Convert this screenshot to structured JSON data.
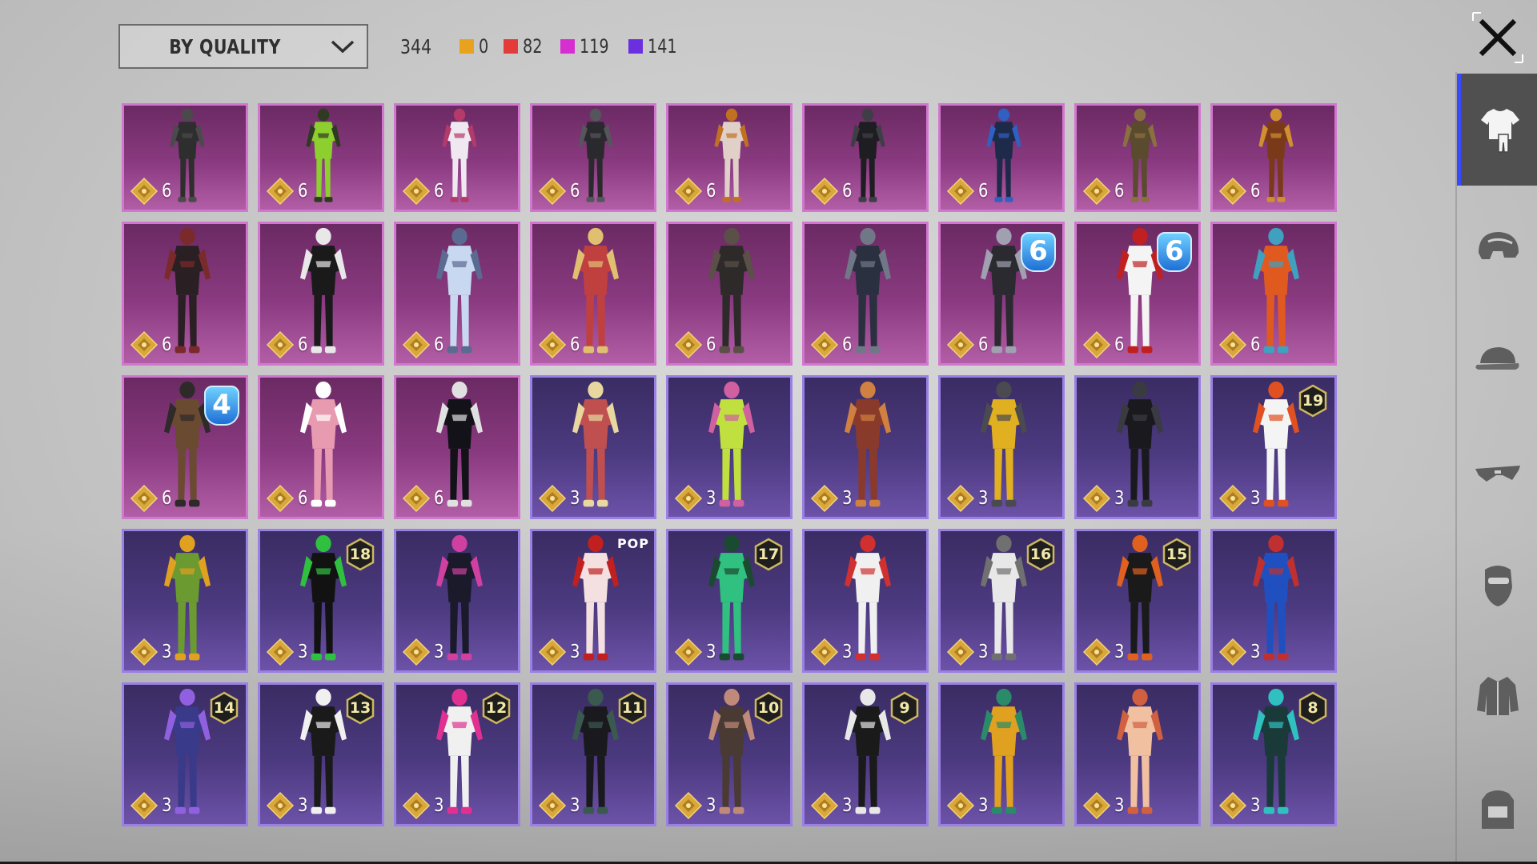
{
  "toolbar": {
    "sort_label": "BY QUALITY",
    "total_count": "344",
    "quality_counts": [
      {
        "value": "0",
        "color": "#e8a21e"
      },
      {
        "value": "82",
        "color": "#e53a3a"
      },
      {
        "value": "119",
        "color": "#d62ed0"
      },
      {
        "value": "141",
        "color": "#6b2fe0"
      }
    ]
  },
  "colors": {
    "mythic_border": "#d277cf",
    "legendary_border": "#9a7fe4",
    "active_tab_accent": "#3949ff"
  },
  "sidebar": {
    "tabs": [
      {
        "icon": "outfit-icon",
        "active": true
      },
      {
        "icon": "helmet-icon",
        "active": false
      },
      {
        "icon": "cap-icon",
        "active": false
      },
      {
        "icon": "sunglasses-icon",
        "active": false
      },
      {
        "icon": "mask-icon",
        "active": false
      },
      {
        "icon": "jacket-icon",
        "active": false
      },
      {
        "icon": "backpack-icon",
        "active": false
      }
    ]
  },
  "items": [
    {
      "rarity": "mythic",
      "points": "6",
      "badge": null,
      "palette": [
        "#2e2e2e",
        "#4a4a4a"
      ]
    },
    {
      "rarity": "mythic",
      "points": "6",
      "badge": null,
      "palette": [
        "#8ccf2e",
        "#2f3a22"
      ]
    },
    {
      "rarity": "mythic",
      "points": "6",
      "badge": null,
      "palette": [
        "#f0e8f0",
        "#b33a6a"
      ]
    },
    {
      "rarity": "mythic",
      "points": "6",
      "badge": null,
      "palette": [
        "#2a2a2e",
        "#55555c"
      ]
    },
    {
      "rarity": "mythic",
      "points": "6",
      "badge": null,
      "palette": [
        "#e0d0c8",
        "#c07020"
      ]
    },
    {
      "rarity": "mythic",
      "points": "6",
      "badge": null,
      "palette": [
        "#1e1e22",
        "#3e3e46"
      ]
    },
    {
      "rarity": "mythic",
      "points": "6",
      "badge": null,
      "palette": [
        "#1e2a4a",
        "#3060c0"
      ]
    },
    {
      "rarity": "mythic",
      "points": "6",
      "badge": null,
      "palette": [
        "#5a4a2e",
        "#8a7040"
      ]
    },
    {
      "rarity": "mythic",
      "points": "6",
      "badge": null,
      "palette": [
        "#7a3a1a",
        "#d09030"
      ]
    },
    {
      "rarity": "mythic",
      "points": "6",
      "badge": null,
      "palette": [
        "#2a2024",
        "#7a2a2a"
      ]
    },
    {
      "rarity": "mythic",
      "points": "6",
      "badge": null,
      "palette": [
        "#1a1a1a",
        "#e8e8e8"
      ]
    },
    {
      "rarity": "mythic",
      "points": "6",
      "badge": null,
      "palette": [
        "#c8d8f0",
        "#5a6a90"
      ]
    },
    {
      "rarity": "mythic",
      "points": "6",
      "badge": null,
      "palette": [
        "#c04040",
        "#e0c070"
      ]
    },
    {
      "rarity": "mythic",
      "points": "6",
      "badge": null,
      "palette": [
        "#2e2a2a",
        "#5a5048"
      ]
    },
    {
      "rarity": "mythic",
      "points": "6",
      "badge": null,
      "palette": [
        "#2a3040",
        "#707888"
      ]
    },
    {
      "rarity": "mythic",
      "points": "6",
      "badge": {
        "type": "blue",
        "text": "6"
      },
      "palette": [
        "#2a2a30",
        "#a0a0b0"
      ]
    },
    {
      "rarity": "mythic",
      "points": "6",
      "badge": {
        "type": "blue",
        "text": "6"
      },
      "palette": [
        "#f4f4f4",
        "#c02020"
      ]
    },
    {
      "rarity": "mythic",
      "points": "6",
      "badge": null,
      "palette": [
        "#e05a20",
        "#40a0c0"
      ]
    },
    {
      "rarity": "mythic",
      "points": "6",
      "badge": {
        "type": "blue",
        "text": "4"
      },
      "palette": [
        "#6a4a30",
        "#2e2a2a"
      ]
    },
    {
      "rarity": "mythic",
      "points": "6",
      "badge": null,
      "palette": [
        "#e89ab0",
        "#ffffff"
      ]
    },
    {
      "rarity": "mythic",
      "points": "6",
      "badge": null,
      "palette": [
        "#121218",
        "#e0e0e0"
      ]
    },
    {
      "rarity": "legendary",
      "points": "3",
      "badge": null,
      "palette": [
        "#c05050",
        "#e8d8a0"
      ]
    },
    {
      "rarity": "legendary",
      "points": "3",
      "badge": null,
      "palette": [
        "#c0e040",
        "#d060a0"
      ]
    },
    {
      "rarity": "legendary",
      "points": "3",
      "badge": null,
      "palette": [
        "#8a3a2a",
        "#d08040"
      ]
    },
    {
      "rarity": "legendary",
      "points": "3",
      "badge": null,
      "palette": [
        "#e0b020",
        "#4a4a50"
      ]
    },
    {
      "rarity": "legendary",
      "points": "3",
      "badge": null,
      "palette": [
        "#1a1a1e",
        "#3a3a42"
      ]
    },
    {
      "rarity": "legendary",
      "points": "3",
      "badge": {
        "type": "level",
        "text": "19"
      },
      "palette": [
        "#f4f4f4",
        "#e05020"
      ]
    },
    {
      "rarity": "legendary",
      "points": "3",
      "badge": null,
      "palette": [
        "#6a9a30",
        "#e0a020"
      ]
    },
    {
      "rarity": "legendary",
      "points": "3",
      "badge": {
        "type": "level",
        "text": "18"
      },
      "palette": [
        "#121212",
        "#30c040"
      ]
    },
    {
      "rarity": "legendary",
      "points": "3",
      "badge": null,
      "palette": [
        "#1a1a2a",
        "#d040a0"
      ]
    },
    {
      "rarity": "legendary",
      "points": "3",
      "badge": {
        "type": "pop",
        "text": "POP"
      },
      "palette": [
        "#f4e0e0",
        "#c02020"
      ]
    },
    {
      "rarity": "legendary",
      "points": "3",
      "badge": {
        "type": "level",
        "text": "17"
      },
      "palette": [
        "#30c080",
        "#1a4a30"
      ]
    },
    {
      "rarity": "legendary",
      "points": "3",
      "badge": null,
      "palette": [
        "#f0f0f0",
        "#d03030"
      ]
    },
    {
      "rarity": "legendary",
      "points": "3",
      "badge": {
        "type": "level",
        "text": "16"
      },
      "palette": [
        "#e8e8e8",
        "#707070"
      ]
    },
    {
      "rarity": "legendary",
      "points": "3",
      "badge": {
        "type": "level",
        "text": "15"
      },
      "palette": [
        "#1a1a1a",
        "#e06020"
      ]
    },
    {
      "rarity": "legendary",
      "points": "3",
      "badge": null,
      "palette": [
        "#2050c0",
        "#c03030"
      ]
    },
    {
      "rarity": "legendary",
      "points": "3",
      "badge": {
        "type": "level",
        "text": "14"
      },
      "palette": [
        "#3a3a8a",
        "#9060e0"
      ]
    },
    {
      "rarity": "legendary",
      "points": "3",
      "badge": {
        "type": "level",
        "text": "13"
      },
      "palette": [
        "#1a1a1a",
        "#f0f0f0"
      ]
    },
    {
      "rarity": "legendary",
      "points": "3",
      "badge": {
        "type": "level",
        "text": "12"
      },
      "palette": [
        "#f0f0f0",
        "#e03090"
      ]
    },
    {
      "rarity": "legendary",
      "points": "3",
      "badge": {
        "type": "level",
        "text": "11"
      },
      "palette": [
        "#1a1a1e",
        "#3a5a50"
      ]
    },
    {
      "rarity": "legendary",
      "points": "3",
      "badge": {
        "type": "level",
        "text": "10"
      },
      "palette": [
        "#4a3a34",
        "#c08a7a"
      ]
    },
    {
      "rarity": "legendary",
      "points": "3",
      "badge": {
        "type": "level",
        "text": "9"
      },
      "palette": [
        "#1a1a1a",
        "#e8e8e8"
      ]
    },
    {
      "rarity": "legendary",
      "points": "3",
      "badge": null,
      "palette": [
        "#e0a020",
        "#2a8a6a"
      ]
    },
    {
      "rarity": "legendary",
      "points": "3",
      "badge": null,
      "palette": [
        "#f0c0a0",
        "#d06040"
      ]
    },
    {
      "rarity": "legendary",
      "points": "3",
      "badge": {
        "type": "level",
        "text": "8"
      },
      "palette": [
        "#1a3a3a",
        "#30c0c0"
      ]
    }
  ]
}
